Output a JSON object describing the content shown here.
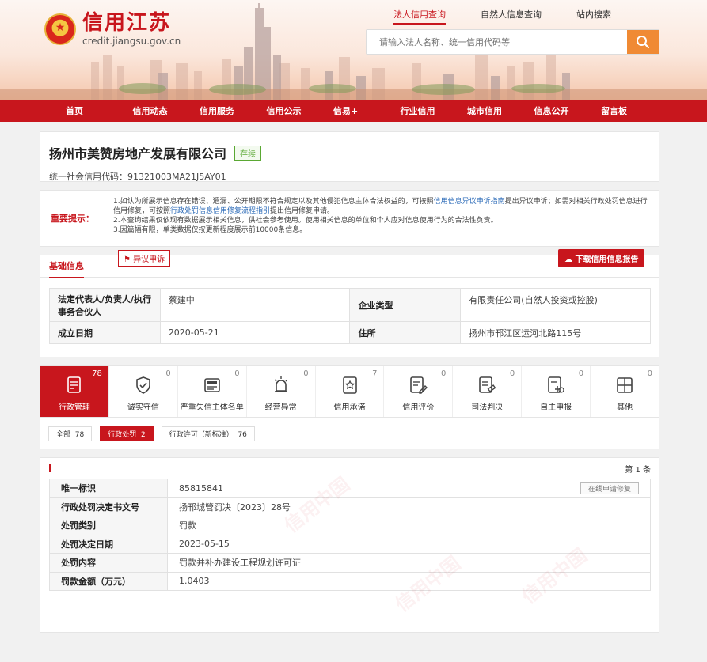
{
  "header": {
    "logo_cn": "信用江苏",
    "logo_url": "credit.jiangsu.gov.cn",
    "search_tabs": [
      "法人信用查询",
      "自然人信息查询",
      "站内搜索"
    ],
    "search_placeholder": "请输入法人名称、统一信用代码等"
  },
  "nav": [
    "首页",
    "信用动态",
    "信用服务",
    "信用公示",
    "信易+",
    "行业信用",
    "城市信用",
    "信息公开",
    "留言板"
  ],
  "company": {
    "name": "扬州市美赞房地产发展有限公司",
    "status": "存续",
    "credit_code_label": "统一社会信用代码：",
    "credit_code": "91321003MA21J5AY01"
  },
  "notice": {
    "label": "重要提示：",
    "line1_a": "1.如认为所展示信息存在错误、遗漏、公开期限不符合规定以及其他侵犯信息主体合法权益的，可按照",
    "line1_link": "信用信息异议申诉指南",
    "line1_b": "提出异议申诉；如需对相关行政处罚信息进行信用修复，可按照",
    "line1_link2": "行政处罚信息信用修复流程指引",
    "line1_c": "提出信用修复申请。",
    "line2": "2.本查询结果仅依现有数据展示相关信息，供社会参考使用。使用相关信息的单位和个人应对信息使用行为的合法性负责。",
    "line3": "3.因篇幅有限，单类数据仅按更新程度展示前10000条信息。",
    "objection_btn": "异议申诉",
    "download_btn": "下载信用信息报告"
  },
  "basic": {
    "title": "基础信息",
    "rows": [
      {
        "k1": "法定代表人/负责人/执行事务合伙人",
        "v1": "蔡建中",
        "k2": "企业类型",
        "v2": "有限责任公司(自然人投资或控股)"
      },
      {
        "k1": "成立日期",
        "v1": "2020-05-21",
        "k2": "住所",
        "v2": "扬州市邗江区运河北路115号"
      }
    ]
  },
  "categories": [
    {
      "label": "行政管理",
      "count": "78",
      "icon": "document-icon"
    },
    {
      "label": "诚实守信",
      "count": "0",
      "icon": "shield-icon"
    },
    {
      "label": "严重失信主体名单",
      "count": "0",
      "icon": "blacklist-icon"
    },
    {
      "label": "经营异常",
      "count": "0",
      "icon": "alarm-icon"
    },
    {
      "label": "信用承诺",
      "count": "7",
      "icon": "pledge-icon"
    },
    {
      "label": "信用评价",
      "count": "0",
      "icon": "evaluation-icon"
    },
    {
      "label": "司法判决",
      "count": "0",
      "icon": "judgment-icon"
    },
    {
      "label": "自主申报",
      "count": "0",
      "icon": "declare-icon"
    },
    {
      "label": "其他",
      "count": "0",
      "icon": "other-icon"
    }
  ],
  "filters": [
    {
      "label": "全部",
      "count": "78"
    },
    {
      "label": "行政处罚",
      "count": "2"
    },
    {
      "label": "行政许可（新标准）",
      "count": "76"
    }
  ],
  "records": {
    "count_text": "第 1 条",
    "repair_btn": "在线申请修复",
    "rows": [
      {
        "k": "唯一标识",
        "v": "85815841"
      },
      {
        "k": "行政处罚决定书文号",
        "v": "扬邗城管罚决〔2023〕28号"
      },
      {
        "k": "处罚类别",
        "v": "罚款"
      },
      {
        "k": "处罚决定日期",
        "v": "2023-05-15"
      },
      {
        "k": "处罚内容",
        "v": "罚款并补办建设工程规划许可证"
      },
      {
        "k": "罚款金额（万元）",
        "v": "1.0403"
      }
    ],
    "watermark": "信用中国"
  },
  "colors": {
    "brand_red": "#c8161d",
    "search_orange": "#f08a34",
    "status_green": "#5aa833"
  }
}
